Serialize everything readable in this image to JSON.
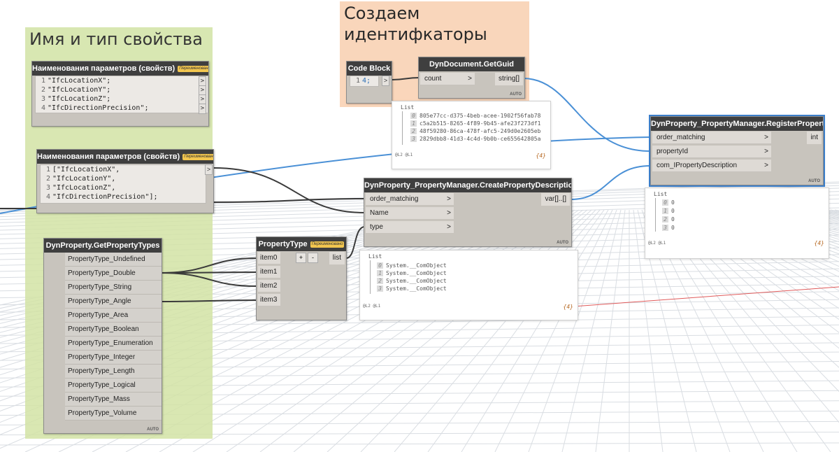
{
  "groups": [
    {
      "id": "g-props",
      "title": "Имя и тип свойства",
      "color": "#d2e3a5"
    },
    {
      "id": "g-ids",
      "title": "Создаем\nидентифкаторы",
      "color": "#f9d2b4"
    }
  ],
  "nodes": {
    "names1": {
      "title": "Наименования параметров (свойств)",
      "badge": "Переименовано",
      "lines": [
        "\"IfcLocationX\";",
        "\"IfcLocationY\";",
        "\"IfcLocationZ\";",
        "\"IfcDirectionPrecision\";"
      ],
      "line_numbers": [
        "1",
        "2",
        "3",
        "4"
      ],
      "out": ">"
    },
    "names2": {
      "title": "Наименования параметров (свойств)",
      "badge": "Переименовано",
      "lines": [
        "[\"IfcLocationX\",",
        "\"IfcLocationY\",",
        "\"IfcLocationZ\",",
        "\"IfcDirectionPrecision\"];"
      ],
      "line_numbers": [
        "1",
        "2",
        "3",
        "4"
      ],
      "out": ">"
    },
    "codeblock": {
      "title": "Code Block",
      "lines": [
        "4;"
      ],
      "line_numbers": [
        "1"
      ],
      "out": ">"
    },
    "getguid": {
      "title": "DynDocument.GetGuid",
      "inputs": [
        "count"
      ],
      "output": "string[]",
      "auto": "AUTO",
      "arrow": ">"
    },
    "register": {
      "title": "DynProperty_PropertyManager.RegisterProperty",
      "inputs": [
        "order_matching",
        "propertyId",
        "com_IPropertyDescription"
      ],
      "output": "int",
      "auto": "AUTO",
      "arrow": ">"
    },
    "create": {
      "title": "DynProperty_PropertyManager.CreatePropertyDescription",
      "inputs": [
        "order_matching",
        "Name",
        "type"
      ],
      "output": "var[]..[]",
      "auto": "AUTO",
      "arrow": ">"
    },
    "types": {
      "title": "DynProperty.GetPropertyTypes",
      "auto": "AUTO",
      "items": [
        "PropertyType_Undefined",
        "PropertyType_Double",
        "PropertyType_String",
        "PropertyType_Angle",
        "PropertyType_Area",
        "PropertyType_Boolean",
        "PropertyType_Enumeration",
        "PropertyType_Integer",
        "PropertyType_Length",
        "PropertyType_Logical",
        "PropertyType_Mass",
        "PropertyType_Volume"
      ]
    },
    "ptype": {
      "title": "PropertyType",
      "badge": "Переименовано",
      "inputs": [
        "item0",
        "item1",
        "item2",
        "item3"
      ],
      "output": "list",
      "plus": "+",
      "minus": "-"
    }
  },
  "previews": {
    "guids": {
      "title": "List",
      "indices": [
        "0",
        "1",
        "2",
        "3"
      ],
      "values": [
        "805e77cc-d375-4beb-acee-1902f56fab78",
        "c5a2b515-8265-4f89-9b45-afe23f273df1",
        "48f59280-86ca-478f-afc5-249d0e2605eb",
        "2829dbb8-41d3-4c4d-9b0b-ce655642805a"
      ],
      "levels": "@L2 @L1",
      "count": "{4}"
    },
    "ints": {
      "title": "List",
      "indices": [
        "0",
        "1",
        "2",
        "3"
      ],
      "values": [
        "0",
        "0",
        "0",
        "0"
      ],
      "levels": "@L2 @L1",
      "count": "{4}"
    },
    "objs": {
      "title": "List",
      "indices": [
        "0",
        "1",
        "2",
        "3"
      ],
      "values": [
        "System.__ComObject",
        "System.__ComObject",
        "System.__ComObject",
        "System.__ComObject"
      ],
      "levels": "@L2 @L1",
      "count": "{4}"
    }
  },
  "colors": {
    "wire_dark": "#3a3a3a",
    "wire_blue": "#4a90d6",
    "selected": "#3b7ec9",
    "axis_red": "#e05a5a"
  }
}
